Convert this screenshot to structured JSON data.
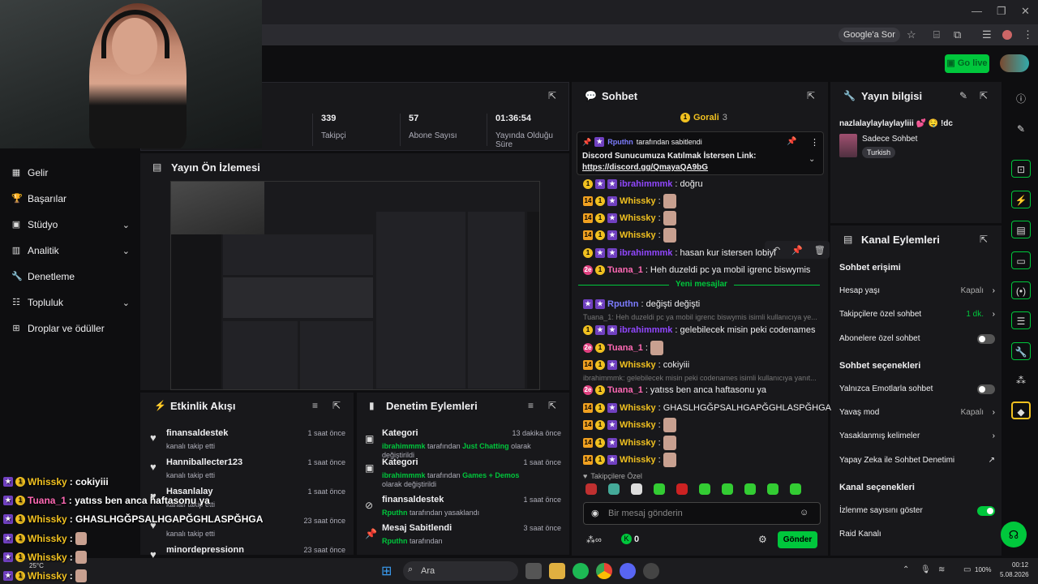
{
  "browser": {
    "google_sor": "Google'a Sor",
    "go_live": "Go live"
  },
  "nav": [
    {
      "label": "Gelir",
      "icon": "revenue-icon"
    },
    {
      "label": "Başarılar",
      "icon": "trophy-icon"
    },
    {
      "label": "Stüdyo",
      "icon": "studio-icon",
      "chevron": true
    },
    {
      "label": "Analitik",
      "icon": "analytics-icon",
      "chevron": true
    },
    {
      "label": "Denetleme",
      "icon": "wrench-icon"
    },
    {
      "label": "Topluluk",
      "icon": "community-icon",
      "chevron": true
    },
    {
      "label": "Droplar ve ödüller",
      "icon": "drops-icon"
    }
  ],
  "stats": [
    {
      "value": "339",
      "label": "Takipçi"
    },
    {
      "value": "57",
      "label": "Abone Sayısı"
    },
    {
      "value": "01:36:54",
      "label": "Yayında Olduğu Süre"
    }
  ],
  "preview": {
    "title": "Yayın Ön İzlemesi"
  },
  "events": {
    "title": "Etkinlik Akışı",
    "items": [
      {
        "name": "finansaldestek",
        "sub": "kanalı takip etti",
        "time": "1 saat önce"
      },
      {
        "name": "Hanniballecter123",
        "sub": "kanalı takip etti",
        "time": "1 saat önce"
      },
      {
        "name": "Hasanlalay",
        "sub": "kanalı takip etti",
        "time": "1 saat önce"
      },
      {
        "name": "",
        "sub": "kanalı takip etti",
        "time": "23 saat önce"
      },
      {
        "name": "minordepressionn",
        "sub": "",
        "time": "23 saat önce"
      }
    ]
  },
  "mod": {
    "title": "Denetim Eylemleri",
    "items": [
      {
        "title": "Kategori",
        "user": "ibrahimmmk",
        "mid": "tarafından",
        "cat": "Just Chatting",
        "tail": "olarak değiştirildi",
        "time": "13 dakika önce"
      },
      {
        "title": "Kategori",
        "user": "ibrahimmmk",
        "mid": "tarafından",
        "cat": "Games + Demos",
        "tail": "olarak değiştirildi",
        "time": "1 saat önce"
      },
      {
        "title": "finansaldestek",
        "user": "Rputhn",
        "mid": "tarafından yasaklandı",
        "cat": "",
        "tail": "",
        "time": "1 saat önce"
      },
      {
        "title": "Mesaj Sabitlendi",
        "user": "Rputhn",
        "mid": "tarafından",
        "cat": "",
        "tail": "",
        "time": "3 saat önce"
      }
    ]
  },
  "chat": {
    "title": "Sohbet",
    "gorali": "Gorali",
    "gorali_count": "3",
    "pin_header_user": "Rputhn",
    "pin_header": "tarafından sabitlendi",
    "pin_text": "Discord Sunucumuza Katılmak İstersen Link:",
    "pin_link": "https://discord.gg/QmayaQA9bG",
    "new_messages": "Yeni mesajlar",
    "reply1": "Tuana_1: Heh duzeldi pc ya mobil igrenc biswymis isimli kullanıcıya ye...",
    "reply2": "ibrahimmmk: gelebilecek misin peki codenames isimli kullanıcıya yanıt...",
    "followers_only": "Takipçilere Özel",
    "placeholder": "Bir mesaj gönderin",
    "points": "0",
    "send": "Gönder",
    "messages": [
      {
        "user": "ibrahimmmk",
        "text": ": doğru"
      },
      {
        "user": "Whissky",
        "text": ":"
      },
      {
        "user": "Whissky",
        "text": ":"
      },
      {
        "user": "Whissky",
        "text": ":"
      },
      {
        "user": "ibrahimmmk",
        "text": ": hasan kur istersen lobiyi"
      },
      {
        "user": "Tuana_1",
        "text": ": Heh duzeldi pc ya mobil igrenc biswymis"
      },
      {
        "user": "Rputhn",
        "text": ": değişti değişti"
      },
      {
        "user": "ibrahimmmk",
        "text": ": gelebilecek misin peki codenames"
      },
      {
        "user": "Tuana_1",
        "text": ":"
      },
      {
        "user": "Whissky",
        "text": ": cokiyiii"
      },
      {
        "user": "Tuana_1",
        "text": ": yatıss ben anca haftasonu ya"
      },
      {
        "user": "Whissky",
        "text": ": GHASLHGĞPSALHGAPĞGHLASPĞHGA"
      },
      {
        "user": "Whissky",
        "text": ":"
      },
      {
        "user": "Whissky",
        "text": ":"
      },
      {
        "user": "Whissky",
        "text": ":"
      }
    ]
  },
  "info": {
    "title": "Yayın bilgisi",
    "stream_title": "nazlalaylaylaylayliii 💕 🤤 !dc",
    "category": "Sadece Sohbet",
    "tag": "Turkish"
  },
  "actions": {
    "title": "Kanal Eylemleri",
    "h1": "Sohbet erişimi",
    "r1": "Hesap yaşı",
    "r1v": "Kapalı",
    "r2": "Takipçilere özel sohbet",
    "r2v": "1 dk.",
    "r3": "Abonelere özel sohbet",
    "h2": "Sohbet seçenekleri",
    "r4": "Yalnızca Emotlarla sohbet",
    "r5": "Yavaş mod",
    "r5v": "Kapalı",
    "r6": "Yasaklanmış kelimeler",
    "r7": "Yapay Zeka ile Sohbet Denetimi",
    "h3": "Kanal seçenekleri",
    "r8": "İzlenme sayısını göster",
    "r9": "Raid Kanalı"
  },
  "overlay": [
    {
      "user": "Whissky",
      "text": ": cokiyiii"
    },
    {
      "user": "Tuana_1",
      "text": ": yatıss ben anca haftasonu ya"
    },
    {
      "user": "Whissky",
      "text": ": GHASLHGĞPSALHGAPĞGHLASPĞHGA"
    },
    {
      "user": "Whissky",
      "text": ":"
    },
    {
      "user": "Whissky",
      "text": ":"
    },
    {
      "user": "Whissky",
      "text": ":"
    }
  ],
  "taskbar": {
    "weather": "25°C",
    "search": "Ara",
    "battery": "100%",
    "time": "00:12",
    "date": "5.08.2026"
  },
  "colors": {
    "accent": "#00c73c",
    "background": "#0e0e10",
    "panel": "#18181b"
  }
}
